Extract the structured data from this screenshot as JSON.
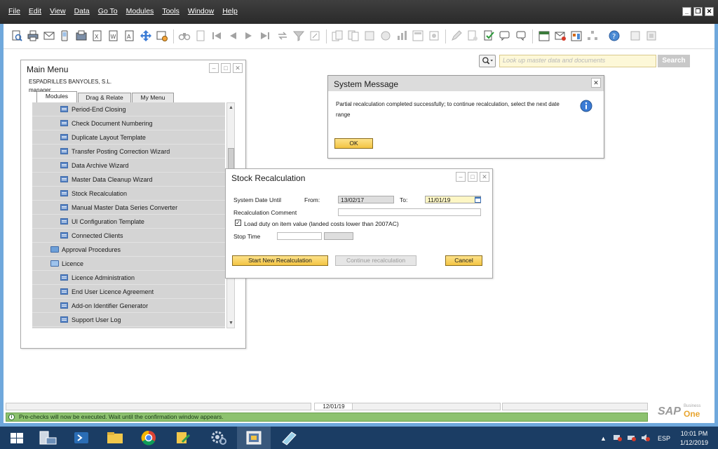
{
  "menubar": [
    "File",
    "Edit",
    "View",
    "Data",
    "Go To",
    "Modules",
    "Tools",
    "Window",
    "Help"
  ],
  "search": {
    "placeholder": "Look up master data and documents",
    "button": "Search"
  },
  "main_menu": {
    "title": "Main Menu",
    "company": "ESPADRILLES BANYOLES, S.L.",
    "user": "manager",
    "tabs": [
      "Modules",
      "Drag & Relate",
      "My Menu"
    ],
    "items": [
      {
        "label": "Period-End Closing",
        "type": "doc"
      },
      {
        "label": "Check Document Numbering",
        "type": "doc"
      },
      {
        "label": "Duplicate Layout Template",
        "type": "doc"
      },
      {
        "label": "Transfer Posting Correction Wizard",
        "type": "doc"
      },
      {
        "label": "Data Archive Wizard",
        "type": "doc"
      },
      {
        "label": "Master Data Cleanup Wizard",
        "type": "doc"
      },
      {
        "label": "Stock Recalculation",
        "type": "doc"
      },
      {
        "label": "Manual Master Data Series Converter",
        "type": "doc"
      },
      {
        "label": "UI Configuration Template",
        "type": "doc"
      },
      {
        "label": "Connected Clients",
        "type": "doc"
      },
      {
        "label": "Approval Procedures",
        "type": "folder"
      },
      {
        "label": "Licence",
        "type": "folder-open"
      },
      {
        "label": "Licence Administration",
        "type": "doc"
      },
      {
        "label": "End User Licence Agreement",
        "type": "doc"
      },
      {
        "label": "Add-on Identifier Generator",
        "type": "doc"
      },
      {
        "label": "Support User Log",
        "type": "doc"
      }
    ]
  },
  "system_message": {
    "title": "System Message",
    "text": "Partial recalculation completed successfully; to continue recalculation, select the next date range",
    "ok": "OK"
  },
  "stock_recalc": {
    "title": "Stock Recalculation",
    "system_date_until": "System Date Until",
    "from_label": "From:",
    "from_value": "13/02/17",
    "to_label": "To:",
    "to_value": "11/01/19",
    "comment_label": "Recalculation Comment",
    "comment_value": "",
    "checkbox_label": "Load duty on item value (landed costs lower than 2007AC)",
    "checkbox_checked": true,
    "stop_time": "Stop Time",
    "start_btn": "Start New Recalculation",
    "continue_btn": "Continue recalculation",
    "cancel_btn": "Cancel"
  },
  "statusbar": {
    "date": "12/01/19",
    "message": "Pre-checks will now be executed. Wait until the confirmation window appears."
  },
  "brand": {
    "name": "SAP",
    "sub1": "Business",
    "sub2": "One"
  },
  "tray": {
    "lang": "ESP",
    "time": "10:01 PM",
    "date": "1/12/2019"
  },
  "colors": {
    "accent": "#f3c443",
    "status_green": "#8dc26f",
    "taskbar": "#1b3d64",
    "frame": "#6fa8dc"
  }
}
